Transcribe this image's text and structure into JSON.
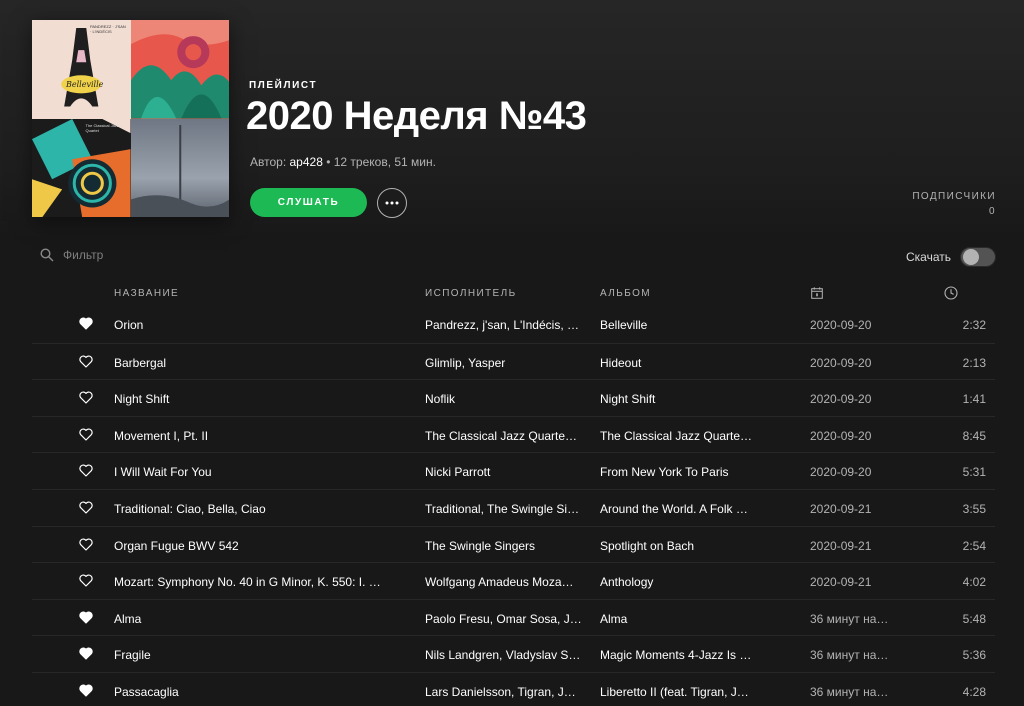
{
  "playlist": {
    "kicker": "ПЛЕЙЛИСТ",
    "title": "2020 Неделя №43",
    "author_prefix": "Автор: ",
    "owner": "ap428",
    "stats": " • 12 треков, 51 мин.",
    "play_label": "СЛУШАТЬ",
    "followers_label": "ПОДПИСЧИКИ",
    "followers_count": "0"
  },
  "cover": {
    "tile1_text": "Belleville",
    "tile1_header": "PANDREZZ · J'SAN · L'INDÉCIS",
    "tile2_color": "#e8574b",
    "tile3_text": "The Classical Jazz Quartet"
  },
  "toolbar": {
    "filter_placeholder": "Фильтр",
    "download_label": "Скачать",
    "download_enabled": false
  },
  "columns": {
    "name": "НАЗВАНИЕ",
    "artist": "ИСПОЛНИТЕЛЬ",
    "album": "АЛЬБОМ",
    "added_icon": "calendar-icon",
    "duration_icon": "clock-icon"
  },
  "colors": {
    "accent": "#1db954",
    "background": "#181818",
    "text_primary": "#ffffff",
    "text_secondary": "#b3b3b3"
  },
  "tracks": [
    {
      "liked": true,
      "name": "Orion",
      "artist": "Pandrezz, j'san, L'Indécis, …",
      "album": "Belleville",
      "added": "2020-09-20",
      "duration": "2:32"
    },
    {
      "liked": false,
      "name": "Barbergal",
      "artist": "Glimlip, Yasper",
      "album": "Hideout",
      "added": "2020-09-20",
      "duration": "2:13"
    },
    {
      "liked": false,
      "name": "Night Shift",
      "artist": "Noflik",
      "album": "Night Shift",
      "added": "2020-09-20",
      "duration": "1:41"
    },
    {
      "liked": false,
      "name": "Movement I, Pt. II",
      "artist": "The Classical Jazz Quarte…",
      "album": "The Classical Jazz Quarte…",
      "added": "2020-09-20",
      "duration": "8:45"
    },
    {
      "liked": false,
      "name": "I Will Wait For You",
      "artist": "Nicki Parrott",
      "album": "From New York To Paris",
      "added": "2020-09-20",
      "duration": "5:31"
    },
    {
      "liked": false,
      "name": "Traditional: Ciao, Bella, Ciao",
      "artist": "Traditional, The Swingle Si…",
      "album": "Around the World. A Folk …",
      "added": "2020-09-21",
      "duration": "3:55"
    },
    {
      "liked": false,
      "name": "Organ Fugue BWV 542",
      "artist": "The Swingle Singers",
      "album": "Spotlight on Bach",
      "added": "2020-09-21",
      "duration": "2:54"
    },
    {
      "liked": false,
      "name": "Mozart: Symphony No. 40 in G Minor, K. 550: I. …",
      "artist": "Wolfgang Amadeus Moza…",
      "album": "Anthology",
      "added": "2020-09-21",
      "duration": "4:02"
    },
    {
      "liked": true,
      "name": "Alma",
      "artist": "Paolo Fresu, Omar Sosa, J…",
      "album": "Alma",
      "added": "36 минут на…",
      "duration": "5:48"
    },
    {
      "liked": true,
      "name": "Fragile",
      "artist": "Nils Landgren, Vladyslav S…",
      "album": "Magic Moments 4-Jazz Is …",
      "added": "36 минут на…",
      "duration": "5:36"
    },
    {
      "liked": true,
      "name": "Passacaglia",
      "artist": "Lars Danielsson, Tigran, J…",
      "album": "Liberetto II (feat. Tigran, J…",
      "added": "36 минут на…",
      "duration": "4:28"
    }
  ]
}
